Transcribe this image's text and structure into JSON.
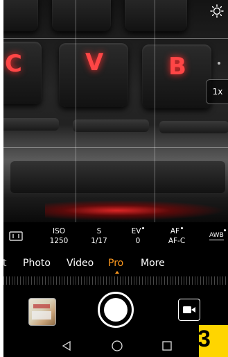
{
  "viewfinder": {
    "keys": [
      "C",
      "V",
      "B"
    ],
    "zoom_label": "1x"
  },
  "pro_params": [
    {
      "name": "ISO",
      "value": "1250",
      "has_dot": false
    },
    {
      "name": "S",
      "value": "1/17",
      "has_dot": false
    },
    {
      "name": "EV",
      "value": "0",
      "has_dot": true
    },
    {
      "name": "AF",
      "value": "AF-C",
      "has_dot": true
    }
  ],
  "awb_label": "AWB",
  "modes": {
    "partial_left": "t",
    "items": [
      "Photo",
      "Video",
      "Pro",
      "More"
    ],
    "active": "Pro"
  },
  "icons": {
    "settings": "settings-icon",
    "aspect": "aspect-ratio-icon",
    "video": "video-camera-icon",
    "back": "back-triangle-icon",
    "home": "home-circle-icon",
    "recent": "recent-apps-square-icon"
  },
  "colors": {
    "accent": "#ff9a1f",
    "key_letter": "#ff4646",
    "badge": "#ffd500"
  },
  "corner_badge": "3"
}
